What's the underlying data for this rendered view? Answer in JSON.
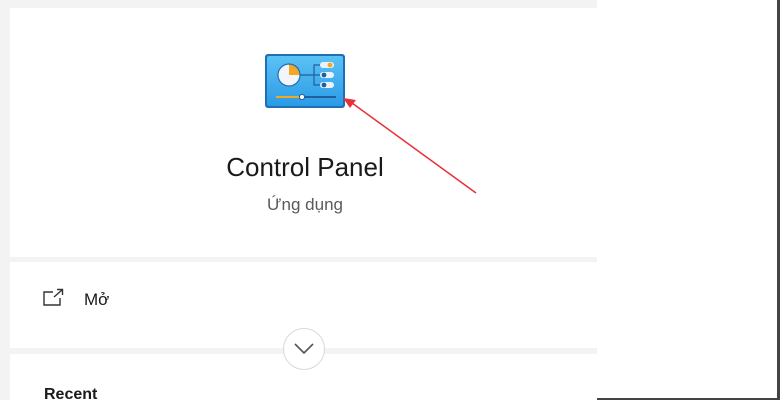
{
  "app": {
    "title": "Control Panel",
    "subtitle": "Ứng dụng",
    "icon": "control-panel-icon"
  },
  "actions": {
    "open_label": "Mở",
    "open_icon": "open-external-icon",
    "expand_icon": "chevron-down-icon"
  },
  "recent": {
    "heading": "Recent"
  },
  "colors": {
    "panel_background": "#f3f3f3",
    "card_background": "#ffffff",
    "annotation_arrow": "#e8303a",
    "icon_blue": "#2b9be6"
  }
}
